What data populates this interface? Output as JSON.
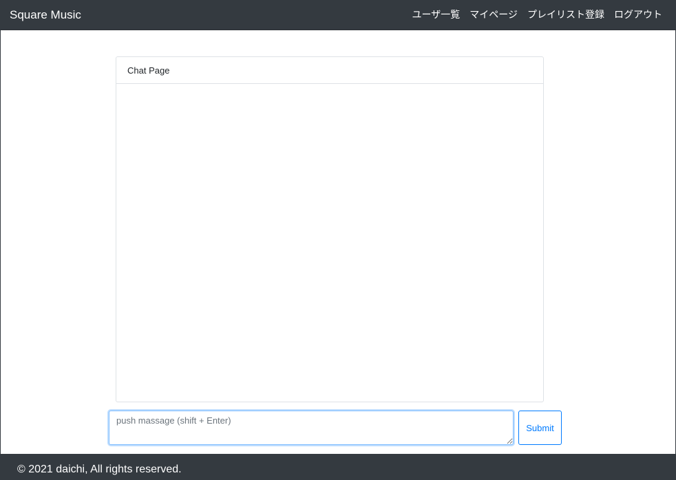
{
  "navbar": {
    "brand": "Square Music",
    "links": [
      {
        "label": "ユーザ一覧"
      },
      {
        "label": "マイページ"
      },
      {
        "label": "プレイリスト登録"
      },
      {
        "label": "ログアウト"
      }
    ]
  },
  "chat": {
    "title": "Chat Page",
    "messages": []
  },
  "composer": {
    "placeholder": "push massage (shift + Enter)",
    "value": "",
    "submit_label": "Submit"
  },
  "footer": {
    "copyright": "© 2021 daichi, All rights reserved."
  },
  "colors": {
    "navbar_bg": "#343a40",
    "primary": "#007bff",
    "focus_border": "#80bdff"
  }
}
